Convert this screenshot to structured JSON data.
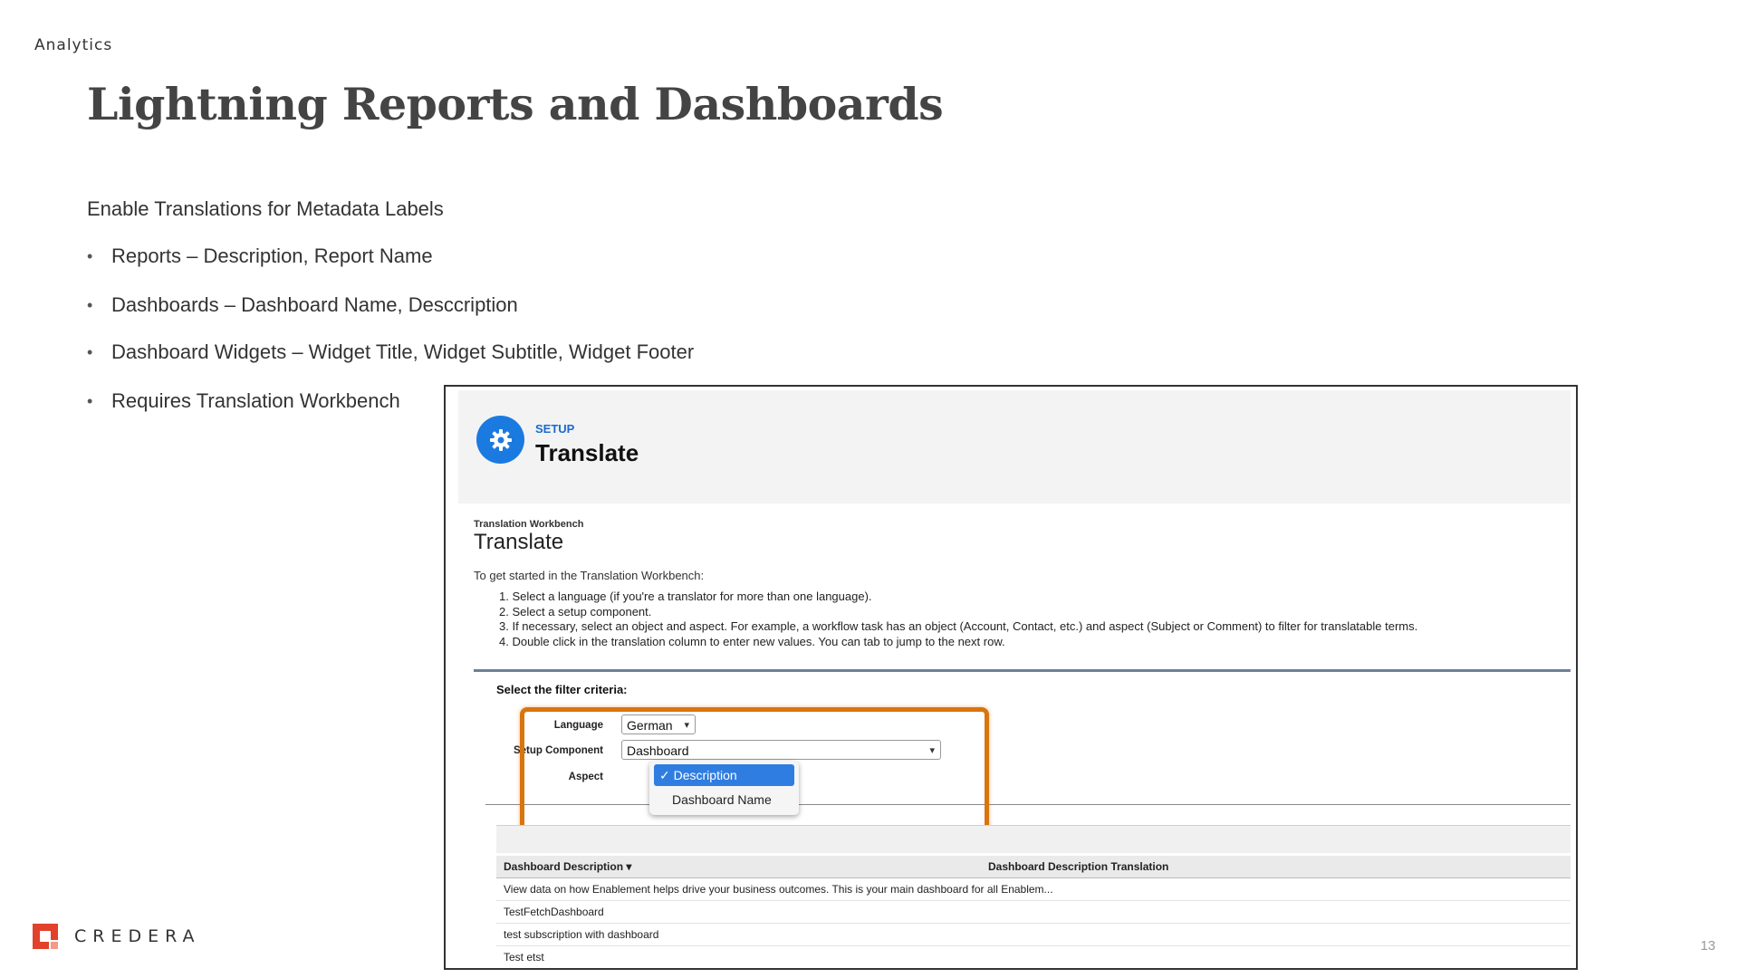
{
  "header": {
    "section": "Analytics",
    "title": "Lightning Reports and Dashboards"
  },
  "content": {
    "intro": "Enable Translations for Metadata Labels",
    "bullets": [
      "Reports – Description, Report Name",
      "Dashboards – Dashboard Name, Desccription",
      "Dashboard Widgets – Widget Title, Widget Subtitle, Widget Footer",
      "Requires Translation Workbench"
    ]
  },
  "screenshot": {
    "setup_kicker": "SETUP",
    "setup_title": "Translate",
    "wb_kicker": "Translation Workbench",
    "wb_title": "Translate",
    "wb_intro": "To get started in the Translation Workbench:",
    "steps": [
      "1. Select a language (if you're a translator for more than one language).",
      "2. Select a setup component.",
      "3. If necessary, select an object and aspect. For example, a workflow task has an object (Account, Contact, etc.) and aspect (Subject or Comment) to filter for translatable terms.",
      "4. Double click in the translation column to enter new values. You can tab to jump to the next row."
    ],
    "filter_label": "Select the filter criteria:",
    "language_label": "Language",
    "language_value": "German",
    "component_label": "Setup Component",
    "component_value": "Dashboard",
    "aspect_label": "Aspect",
    "aspect_options": [
      "✓ Description",
      "Dashboard Name"
    ],
    "columns": [
      "Dashboard Description ▾",
      "Dashboard Description Translation"
    ],
    "rows": [
      "View data on how Enablement helps drive your business outcomes. This is your main dashboard for all Enablem...",
      "TestFetchDashboard",
      "test subscription with dashboard",
      "Test etst"
    ],
    "highlight_color": "#d8750e",
    "accent_color": "#1b7ae0"
  },
  "footer": {
    "brand": "CREDERA",
    "page_number": "13"
  }
}
